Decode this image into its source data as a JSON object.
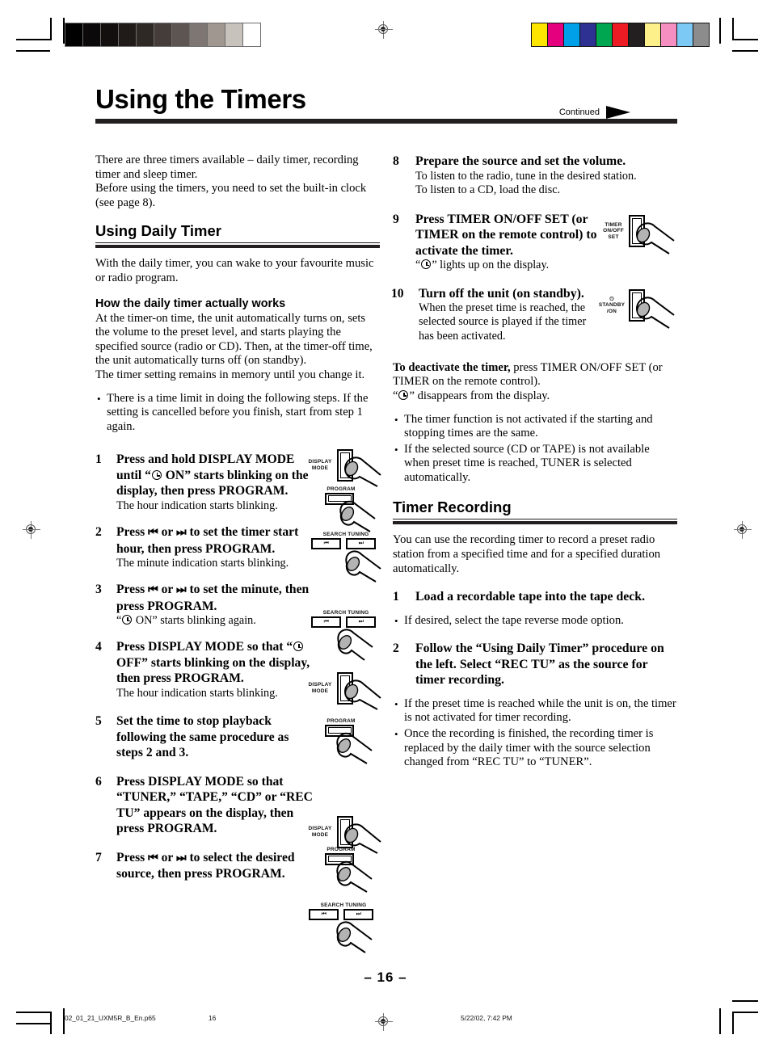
{
  "printer_marks": {
    "grayscale_steps": [
      "#000000",
      "#0b0909",
      "#120f0e",
      "#201b19",
      "#2f2926",
      "#453d39",
      "#5d5551",
      "#7e7672",
      "#a09791",
      "#c8c2bd",
      "#ffffff"
    ],
    "color_steps": [
      "#ffe600",
      "#e5007d",
      "#00a0e9",
      "#2e3192",
      "#00a650",
      "#ed1c24",
      "#231f20",
      "#fdf08a",
      "#f58fc2",
      "#7cc9f5",
      "#8c8c8c"
    ]
  },
  "header": {
    "title": "Using the Timers",
    "continued_label": "Continued"
  },
  "intro": {
    "line1": "There are three timers available – daily timer, recording timer and sleep timer.",
    "line2": "Before using the timers, you need to set the built-in clock (see page 8)."
  },
  "section_daily": {
    "heading": "Using Daily Timer",
    "lead": "With the daily timer, you can wake to your favourite music or radio program.",
    "how_heading": "How the daily timer actually works",
    "how_body": "At the timer-on time, the unit automatically turns on, sets the volume to the preset level, and starts playing the specified source (radio or CD). Then, at the timer-off time, the unit automatically turns off (on standby).",
    "how_body2": "The timer setting remains in memory until you change it.",
    "note": "There is a time limit in doing the following steps. If the setting is cancelled before you finish, start from step 1 again."
  },
  "steps_left": [
    {
      "num": "1",
      "head_pre": "Press and hold DISPLAY MODE until “",
      "head_post": " ON” starts blinking on the display, then press PROGRAM.",
      "sub": "The hour indication starts blinking.",
      "art": [
        "display-mode-button",
        "program-button"
      ]
    },
    {
      "num": "2",
      "head_pre": "Press ",
      "head_mid": " or ",
      "head_post": " to set the timer start hour, then press PROGRAM.",
      "sub": "The minute indication starts blinking.",
      "art": [
        "search-tuning-buttons"
      ]
    },
    {
      "num": "3",
      "head_pre": "Press ",
      "head_mid": " or ",
      "head_post": " to set the minute, then press PROGRAM.",
      "sub_pre": "“",
      "sub_post": " ON”  starts blinking again.",
      "art": [
        "search-tuning-buttons"
      ]
    },
    {
      "num": "4",
      "head_pre": "Press DISPLAY MODE so that “",
      "head_post": " OFF” starts blinking on the display, then press PROGRAM.",
      "sub": "The hour indication starts blinking.",
      "art": [
        "display-mode-button",
        "program-button"
      ]
    },
    {
      "num": "5",
      "head": "Set the time to stop playback following the same procedure as steps 2 and 3.",
      "art": []
    },
    {
      "num": "6",
      "head": "Press DISPLAY MODE so that “TUNER,” “TAPE,” “CD” or “REC TU” appears on the display, then press PROGRAM.",
      "art": [
        "display-mode-button",
        "program-button"
      ]
    },
    {
      "num": "7",
      "head_pre": "Press ",
      "head_mid": " or ",
      "head_post": " to select the desired source, then press PROGRAM.",
      "art": [
        "search-tuning-buttons"
      ]
    }
  ],
  "steps_right": [
    {
      "num": "8",
      "head": "Prepare the source and set the volume.",
      "sub1": "To listen to the radio, tune in the desired station.",
      "sub2": "To listen to a CD, load the disc."
    },
    {
      "num": "9",
      "head": "Press TIMER ON/OFF SET (or TIMER on the remote control) to activate the timer.",
      "sub_pre": "“",
      "sub_post": "” lights up on the display."
    },
    {
      "num": "10",
      "head": "Turn off the unit (on standby).",
      "sub": "When the preset time is reached, the selected source is played if the timer has been activated."
    }
  ],
  "deactivate": {
    "bold": "To deactivate the timer,",
    "rest": " press TIMER ON/OFF SET (or TIMER on the remote control).",
    "line2_pre": "“",
    "line2_post": "” disappears from the display."
  },
  "deactivate_notes": [
    "The timer function is not activated if the starting and stopping times are the same.",
    "If the selected source (CD or TAPE) is not available when preset time is reached, TUNER is selected automatically."
  ],
  "section_recording": {
    "heading": "Timer Recording",
    "lead": "You can use the recording timer to record a preset radio station from a specified time and for a specified duration automatically.",
    "step1_num": "1",
    "step1_head": "Load a recordable tape into the tape deck.",
    "step1_note": "If desired, select the tape reverse mode option.",
    "step2_num": "2",
    "step2_head": "Follow the “Using Daily Timer” procedure on the left. Select “REC TU” as the source for timer recording.",
    "notes": [
      "If the preset time is reached while the unit is on, the timer is not activated for timer recording.",
      "Once the recording is finished, the recording timer is replaced by the daily timer with the source selection changed from “REC TU” to “TUNER”."
    ]
  },
  "button_art": {
    "display_mode": "DISPLAY\nMODE",
    "display_mode_l1": "DISPLAY",
    "display_mode_l2": "MODE",
    "program": "PROGRAM",
    "search_tuning": "SEARCH TUNING",
    "prev_glyph": "⏮",
    "next_glyph": "⏭",
    "timer_l1": "TIMER",
    "timer_l2": "ON/OFF",
    "timer_l3": "SET",
    "standby_l1": "⏻",
    "standby_l2": "STANDBY",
    "standby_l3": "/ON"
  },
  "footer": {
    "page_number": "– 16 –",
    "file_name": "02_01_21_UXM5R_B_En.p65",
    "folio": "16",
    "timestamp": "5/22/02, 7:42 PM"
  }
}
